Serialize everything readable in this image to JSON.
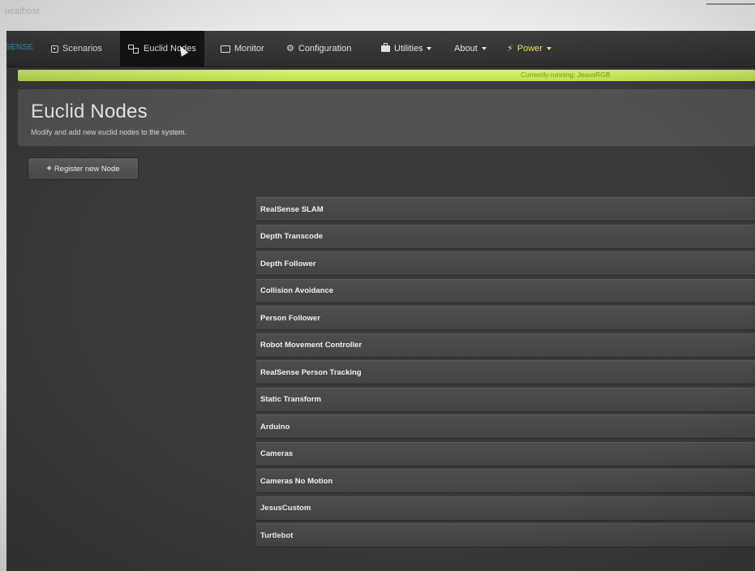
{
  "browser": {
    "tab_label": "ucalhost"
  },
  "navbar": {
    "brand": "SENSE",
    "items": [
      {
        "label": "Scenarios",
        "icon": "scenarios-icon"
      },
      {
        "label": "Euclid Nodes",
        "icon": "nodes-icon",
        "active": true
      },
      {
        "label": "Monitor",
        "icon": "monitor-icon"
      },
      {
        "label": "Configuration",
        "icon": "cogs-icon"
      },
      {
        "label": "Utilities",
        "icon": "briefcase-icon",
        "dropdown": true
      },
      {
        "label": "About",
        "dropdown": true
      },
      {
        "label": "Power",
        "icon": "bolt-icon",
        "dropdown": true
      }
    ]
  },
  "status": {
    "text": "Currently running: JesusRGB",
    "color": "#c7e85a"
  },
  "header": {
    "title": "Euclid Nodes",
    "subtitle": "Modify and add new euclid nodes to the system."
  },
  "actions": {
    "register_label": "Register new Node"
  },
  "nodes": [
    "RealSense SLAM",
    "Depth Transcode",
    "Depth Follower",
    "Collision Avoidance",
    "Person Follower",
    "Robot Movement Controller",
    "RealSense Person Tracking",
    "Static Transform",
    "Arduino",
    "Cameras",
    "Cameras No Motion",
    "JesusCustom",
    "Turtlebot"
  ],
  "colors": {
    "accent_power": "#f0e35a",
    "brand_blue": "#2d9fd1",
    "panel_dark": "#3a3a3a"
  }
}
